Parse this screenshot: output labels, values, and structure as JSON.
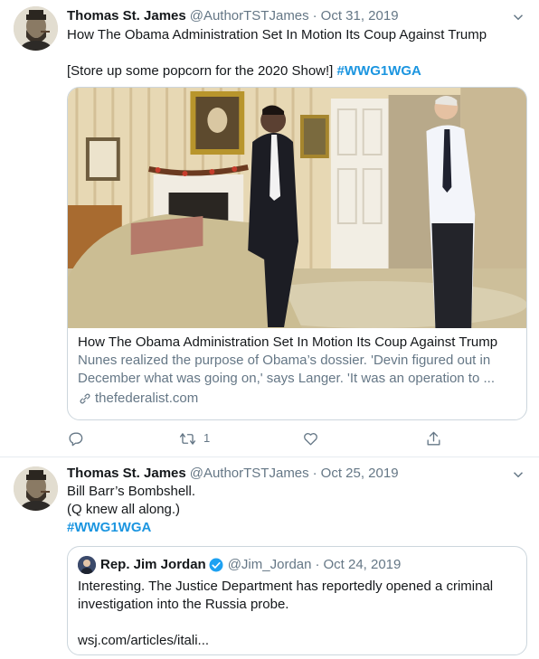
{
  "tweets": [
    {
      "author_name": "Thomas St. James",
      "author_handle": "@AuthorTSTJames",
      "separator": "·",
      "date": "Oct 31, 2019",
      "text_line1": "How The Obama Administration Set In Motion Its Coup Against Trump",
      "text_line2": "[Store up some popcorn for the 2020 Show!]",
      "hashtag": "#WWG1WGA",
      "card": {
        "title": "How The Obama Administration Set In Motion Its Coup Against Trump",
        "description": "Nunes realized the purpose of Obama’s dossier. 'Devin figured out in December what was going on,' says Langer. 'It was an operation to ...",
        "domain": "thefederalist.com"
      },
      "actions": {
        "reply_icon": "reply-icon",
        "retweet_icon": "retweet-icon",
        "retweet_count": "1",
        "like_icon": "heart-icon",
        "share_icon": "share-icon"
      }
    },
    {
      "author_name": "Thomas St. James",
      "author_handle": "@AuthorTSTJames",
      "separator": "·",
      "date": "Oct 25, 2019",
      "text_line1": "Bill Barr’s Bombshell.",
      "text_line2": "(Q knew all along.)",
      "hashtag": "#WWG1WGA",
      "quoted": {
        "author_name": "Rep. Jim Jordan",
        "author_handle": "@Jim_Jordan",
        "separator": "·",
        "date": "Oct 24, 2019",
        "text": "Interesting. The Justice Department has reportedly opened a criminal investigation into the Russia probe.",
        "link": "wsj.com/articles/itali..."
      }
    }
  ],
  "colors": {
    "link": "#1b95e0",
    "secondary": "#657786",
    "border": "#e6ecf0",
    "verified": "#1da1f2"
  }
}
